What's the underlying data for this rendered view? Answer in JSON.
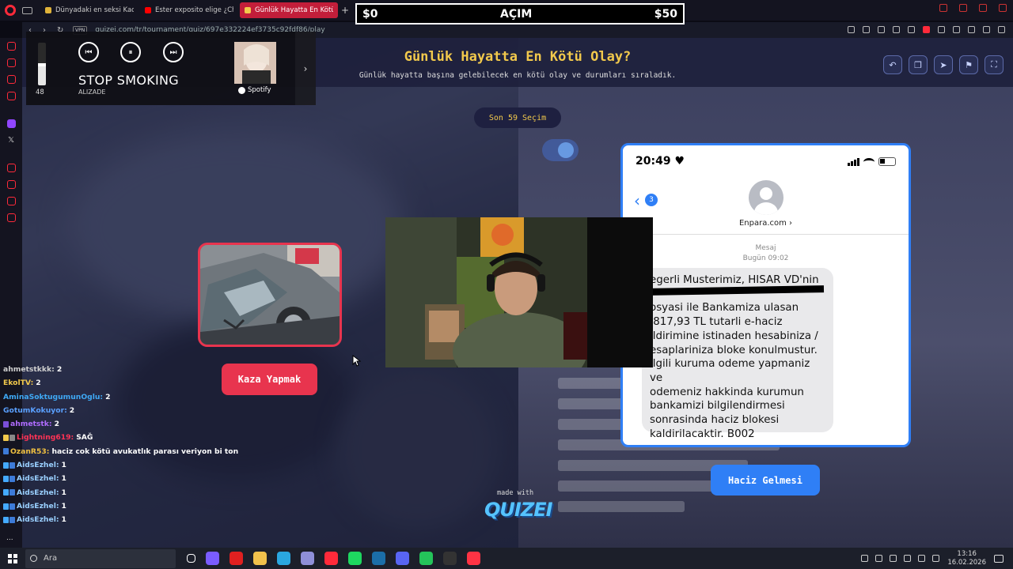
{
  "browser": {
    "tabs": [
      {
        "label": "Dünyadaki en seksi Kadın",
        "active": false,
        "color": "#e0b33a"
      },
      {
        "label": "Ester exposito elige ¿Chila",
        "active": false,
        "color": "#ff0000"
      },
      {
        "label": "Günlük Hayatta En Kötü Ol",
        "active": true,
        "color": "#f2c94c"
      }
    ],
    "new_tab_label": "+",
    "vpn_label": "VPN",
    "url": "quizei.com/tr/tournament/quiz/697e332224ef3735c92fdf86/play",
    "ai_label": "AI"
  },
  "scoreboard": {
    "left": "$0",
    "center": "AÇIM",
    "right": "$50"
  },
  "spotify": {
    "volume": 48,
    "track": "STOP SMOKING",
    "artist": "ALIZADE",
    "brand": "Spotify",
    "volume_fraction": 0.48
  },
  "quiz": {
    "title": "Günlük Hayatta En Kötü Olay?",
    "subtitle": "Günlük hayatta başına gelebilecek en kötü olay ve durumları sıraladık.",
    "round_badge": "Son 59 Seçim",
    "options": [
      {
        "label": "Kaza Yapmak",
        "color": "#e8344e"
      },
      {
        "label": "Haciz Gelmesi",
        "color": "#2f7ff6"
      }
    ],
    "made_with": "made with",
    "brand": "QUIZEI"
  },
  "phone": {
    "time": "20:49 ♥",
    "back_count": "3",
    "sender": "Enpara.com ›",
    "msg_label": "Mesaj",
    "msg_date": "Bugün 09:02",
    "message": "egerli Musterimiz, HISAR VD'nin\n\nosyasi ile Bankamiza ulasan\n.817,93 TL tutarli  e-haciz\nildirimine istinaden   hesabiniza /\nesaplariniza   bloke konulmustur.\nilgili kuruma odeme yapmaniz ve\nodemeniz hakkinda kurumun\nbankamizi bilgilendirmesi\nsonrasinda haciz blokesi\nkaldirilacaktir.   B002"
  },
  "chat": [
    {
      "user": "ahmetstkkk:",
      "text": "2",
      "color": "#d0d0d0",
      "badges": []
    },
    {
      "user": "EkolTV:",
      "text": "2",
      "color": "#f2c94c",
      "badges": []
    },
    {
      "user": "AminaSoktugumunOglu:",
      "text": "2",
      "color": "#3fa9f5",
      "badges": []
    },
    {
      "user": "GotumKokuyor:",
      "text": "2",
      "color": "#5aa0ff",
      "badges": []
    },
    {
      "user": "ahmetstk:",
      "text": "2",
      "color": "#b06cff",
      "badges": [
        "#7b4fd8"
      ]
    },
    {
      "user": "Lightning619:",
      "text": "SAĞ",
      "color": "#ff3355",
      "badges": [
        "#f2c94c",
        "#888"
      ]
    },
    {
      "user": "OzanR53:",
      "text": "haciz cok kötü avukatlık parası veriyon bi ton",
      "color": "#f0c040",
      "badges": [
        "#3d7bd8"
      ]
    },
    {
      "user": "AidsEzhel:",
      "text": "1",
      "color": "#9ad0ff",
      "badges": [
        "#44aaff",
        "#3d7bd8"
      ]
    },
    {
      "user": "AidsEzhel:",
      "text": "1",
      "color": "#9ad0ff",
      "badges": [
        "#44aaff",
        "#3d7bd8"
      ]
    },
    {
      "user": "AidsEzhel:",
      "text": "1",
      "color": "#9ad0ff",
      "badges": [
        "#44aaff",
        "#3d7bd8"
      ]
    },
    {
      "user": "AidsEzhel:",
      "text": "1",
      "color": "#9ad0ff",
      "badges": [
        "#44aaff",
        "#3d7bd8"
      ]
    },
    {
      "user": "AidsEzhel:",
      "text": "1",
      "color": "#9ad0ff",
      "badges": [
        "#44aaff",
        "#3d7bd8"
      ]
    }
  ],
  "chat_more": "...",
  "taskbar": {
    "search_placeholder": "Ara",
    "time": "13:16",
    "date": "16.02.2026",
    "apps": [
      "task-view-icon",
      "copilot-icon",
      "youtube-icon",
      "file-explorer-icon",
      "edge-icon",
      "vpn-icon",
      "opera-icon",
      "spotify-icon",
      "steam-icon",
      "discord-icon",
      "stream-icon",
      "obs-icon",
      "app-icon"
    ]
  }
}
